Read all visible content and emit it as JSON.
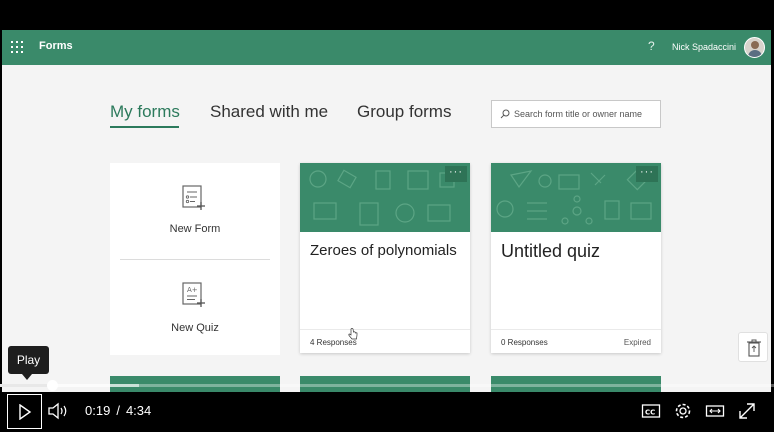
{
  "app": {
    "name": "Forms",
    "help_label": "?",
    "user_name": "Nick Spadaccini",
    "accent_color": "#3a8a6a"
  },
  "tabs": [
    {
      "label": "My forms",
      "active": true
    },
    {
      "label": "Shared with me",
      "active": false
    },
    {
      "label": "Group forms",
      "active": false
    }
  ],
  "search": {
    "placeholder": "Search form title or owner name",
    "icon": "search-icon"
  },
  "new_items": [
    {
      "label": "New Form",
      "icon": "new-form-icon"
    },
    {
      "label": "New Quiz",
      "icon": "new-quiz-icon"
    }
  ],
  "forms": [
    {
      "title": "Zeroes of polynomials",
      "responses": "4 Responses",
      "status": "",
      "more_label": "···"
    },
    {
      "title": "Untitled quiz",
      "responses": "0 Responses",
      "status": "Expired",
      "more_label": "···"
    }
  ],
  "player": {
    "tooltip": "Play",
    "current_time": "0:19",
    "separator": "/",
    "duration": "4:34",
    "progress_fraction": 0.069,
    "buffered_fraction": 0.18,
    "icons": [
      "play-icon",
      "volume-icon",
      "closed-captions-icon",
      "settings-gear-icon",
      "theater-mode-icon",
      "fullscreen-icon"
    ]
  }
}
